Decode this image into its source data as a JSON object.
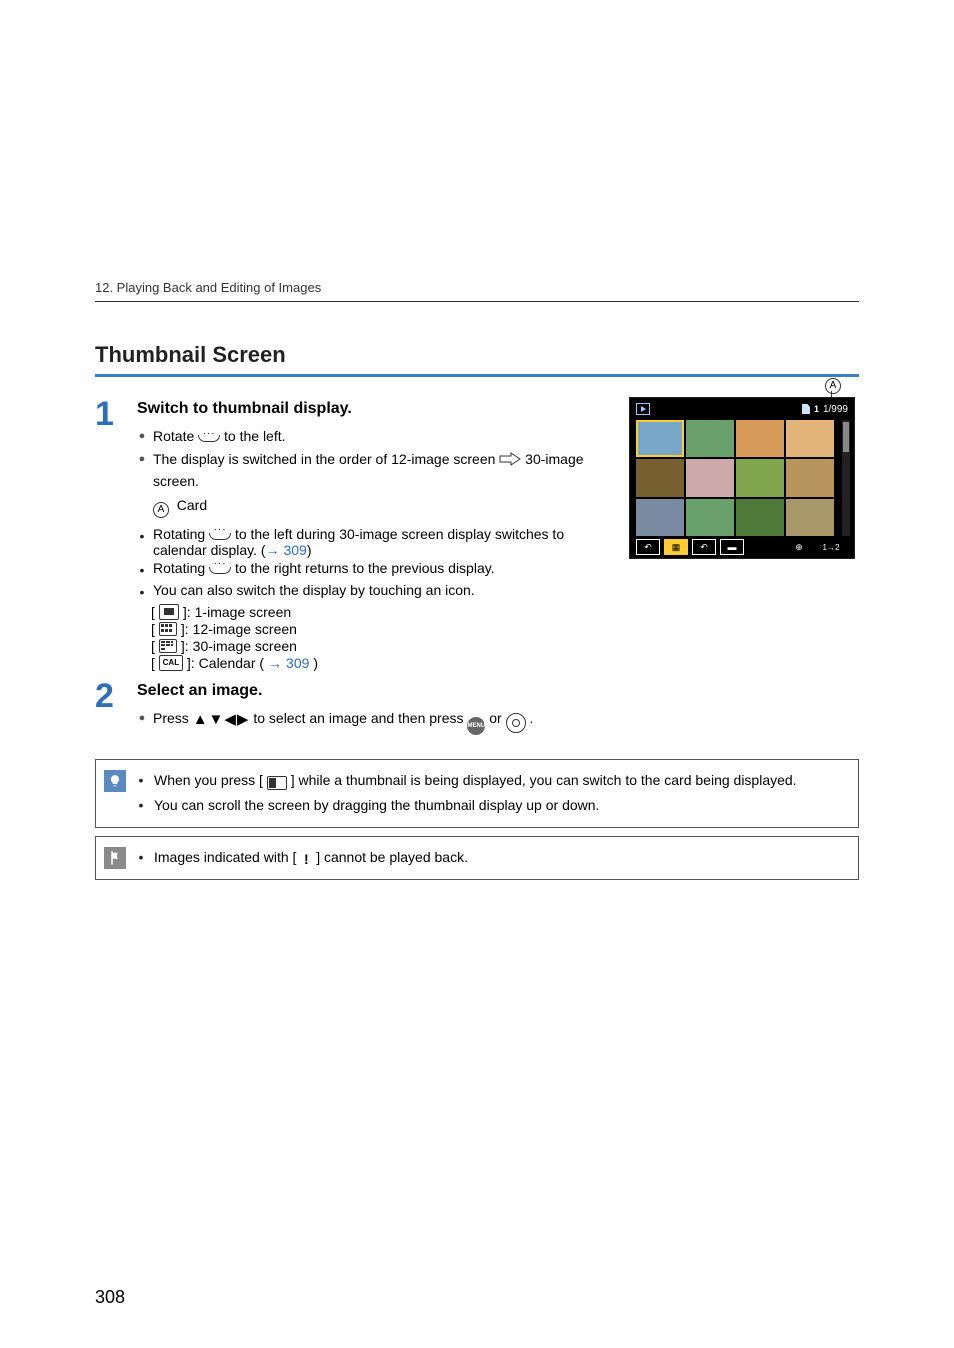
{
  "chapter": "12. Playing Back and Editing of Images",
  "section_title": "Thumbnail Screen",
  "callout": {
    "label_a": "A",
    "counter_card": "1",
    "counter": "1/999"
  },
  "step1": {
    "num": "1",
    "title": "Switch to thumbnail display.",
    "line_rotate_pre": "Rotate ",
    "line_rotate_post": " to the left.",
    "line_switch_a": "The display is switched in the order of 12-image screen ",
    "line_switch_b": " 30-image screen.",
    "card_label": "Card",
    "l2a_pre": "Rotating ",
    "l2a_mid": " to the left during 30-image screen display switches to calendar display. (",
    "l2a_link": "309",
    "l2a_post": ")",
    "l2b_pre": "Rotating ",
    "l2b_post": " to the right returns to the previous display.",
    "l2c": "You can also switch the display by touching an icon.",
    "ic1": "1-image screen",
    "ic12": "12-image screen",
    "ic30": "30-image screen",
    "iccal_pre": "Calendar (",
    "iccal_link": "309",
    "iccal_post": ")",
    "cal_text": "CAL"
  },
  "step2": {
    "num": "2",
    "title": "Select an image.",
    "press_pre": "Press ",
    "press_mid": " to select an image and then press ",
    "or": " or ",
    "end": " .",
    "menu_label": "MENU"
  },
  "notes": {
    "bulb1_a": "When you press [ ",
    "bulb1_b": " ] while a thumbnail is being displayed, you can switch to the card being displayed.",
    "bulb2": "You can scroll the screen by dragging the thumbnail display up or down.",
    "flag_a": "Images indicated with [",
    "flag_b": "] cannot be played back."
  },
  "page_number": "308"
}
